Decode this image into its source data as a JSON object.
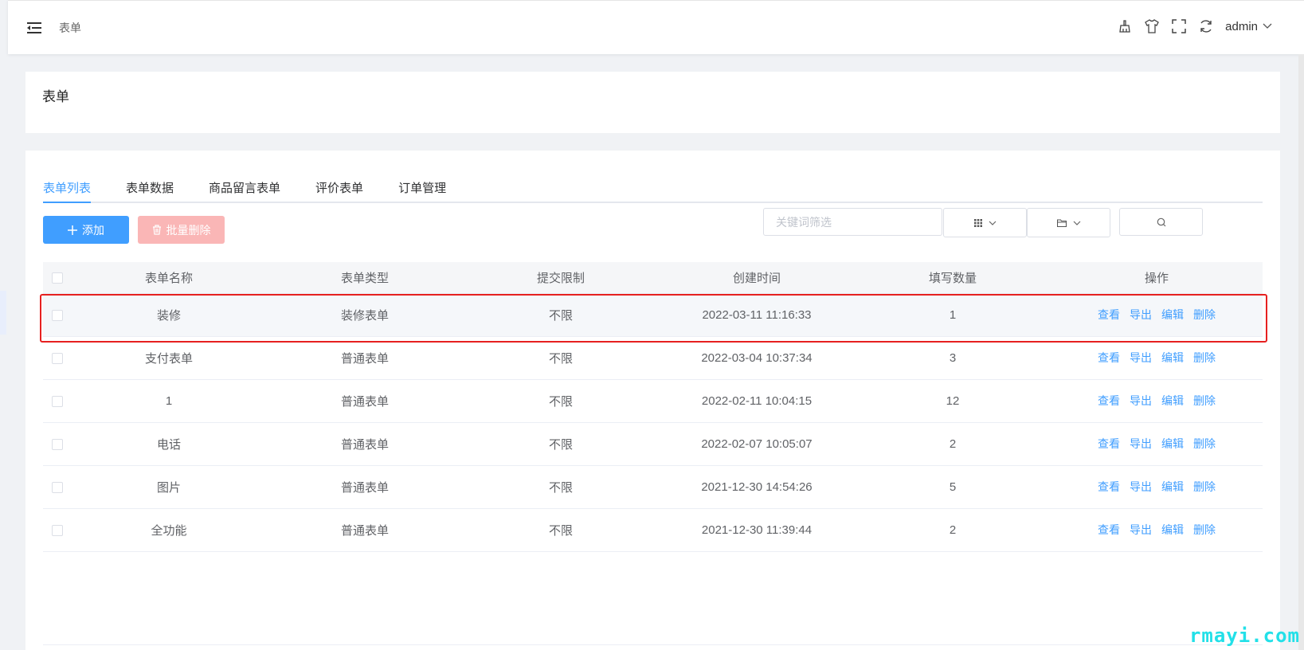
{
  "header": {
    "breadcrumb": "表单",
    "icons": [
      "broom-icon",
      "tshirt-icon",
      "fullscreen-icon",
      "refresh-icon"
    ],
    "user": "admin"
  },
  "page": {
    "title": "表单"
  },
  "tabs": [
    {
      "label": "表单列表",
      "active": true
    },
    {
      "label": "表单数据"
    },
    {
      "label": "商品留言表单"
    },
    {
      "label": "评价表单"
    },
    {
      "label": "订单管理"
    }
  ],
  "toolbar": {
    "add_label": "添加",
    "batch_delete_label": "批量删除",
    "search_placeholder": "关键词筛选"
  },
  "table": {
    "columns": [
      "表单名称",
      "表单类型",
      "提交限制",
      "创建时间",
      "填写数量",
      "操作"
    ],
    "rows": [
      {
        "name": "装修",
        "type": "装修表单",
        "limit": "不限",
        "created": "2022-03-11 11:16:33",
        "count": "1"
      },
      {
        "name": "支付表单",
        "type": "普通表单",
        "limit": "不限",
        "created": "2022-03-04 10:37:34",
        "count": "3"
      },
      {
        "name": "1",
        "type": "普通表单",
        "limit": "不限",
        "created": "2022-02-11 10:04:15",
        "count": "12"
      },
      {
        "name": "电话",
        "type": "普通表单",
        "limit": "不限",
        "created": "2022-02-07 10:05:07",
        "count": "2"
      },
      {
        "name": "图片",
        "type": "普通表单",
        "limit": "不限",
        "created": "2021-12-30 14:54:26",
        "count": "5"
      },
      {
        "name": "全功能",
        "type": "普通表单",
        "limit": "不限",
        "created": "2021-12-30 11:39:44",
        "count": "2"
      }
    ],
    "actions": {
      "view": "查看",
      "export": "导出",
      "edit": "编辑",
      "delete": "删除"
    }
  },
  "colors": {
    "primary": "#409eff",
    "danger_light": "#fab6b6",
    "highlight": "#e62020"
  },
  "watermark": "rmayi.com"
}
